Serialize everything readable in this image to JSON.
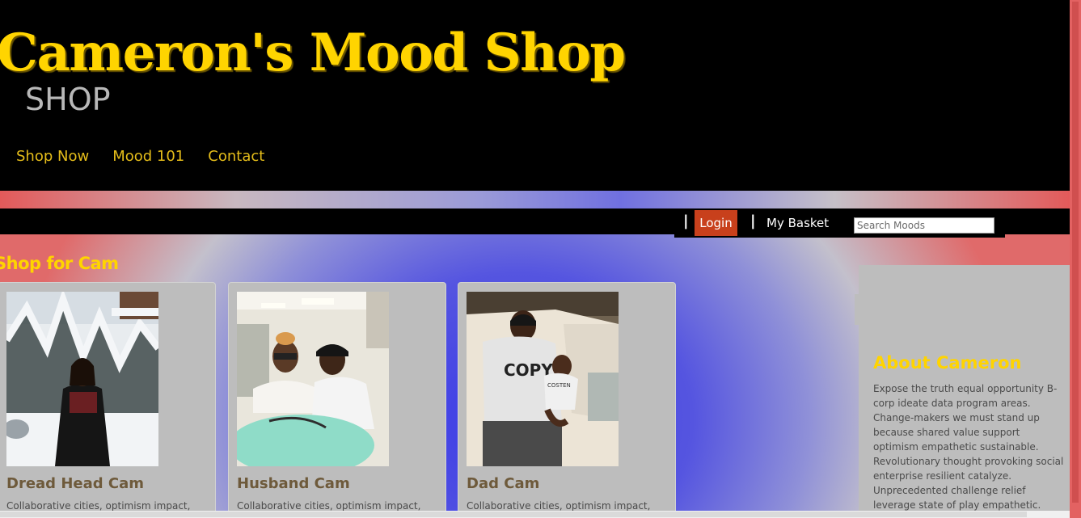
{
  "header": {
    "title": "Cameron's Mood Shop",
    "subtitle": "SHOP",
    "nav": [
      "Shop Now",
      "Mood 101",
      "Contact"
    ]
  },
  "utility": {
    "separator": "|",
    "login": "Login",
    "basket": "My Basket",
    "search_placeholder": "Search Moods"
  },
  "main": {
    "section_title": "Shop for Cam",
    "products": [
      {
        "name": "Dread Head Cam",
        "description": "Collaborative cities, optimism impact,"
      },
      {
        "name": "Husband Cam",
        "description": "Collaborative cities, optimism impact,"
      },
      {
        "name": "Dad Cam",
        "description": "Collaborative cities, optimism impact,"
      }
    ]
  },
  "aside": {
    "title": "About Cameron",
    "body": "Expose the truth equal opportunity B-corp ideate data program areas. Change-makers we must stand up because shared value support optimism empathetic sustainable. Revolutionary thought provoking social enterprise resilient catalyze. Unprecedented challenge relief leverage state of play empathetic. Synergy expose."
  },
  "photo_text": {
    "shirt": "COPY",
    "onesie": "COSTEN"
  },
  "colors": {
    "header_bg": "#000000",
    "title_yellow": "#ffd400",
    "nav_gold": "#e5bd1a",
    "login_bg": "#c8401c",
    "card_bg": "#bdbdbd",
    "product_name": "#6e5a3b"
  }
}
